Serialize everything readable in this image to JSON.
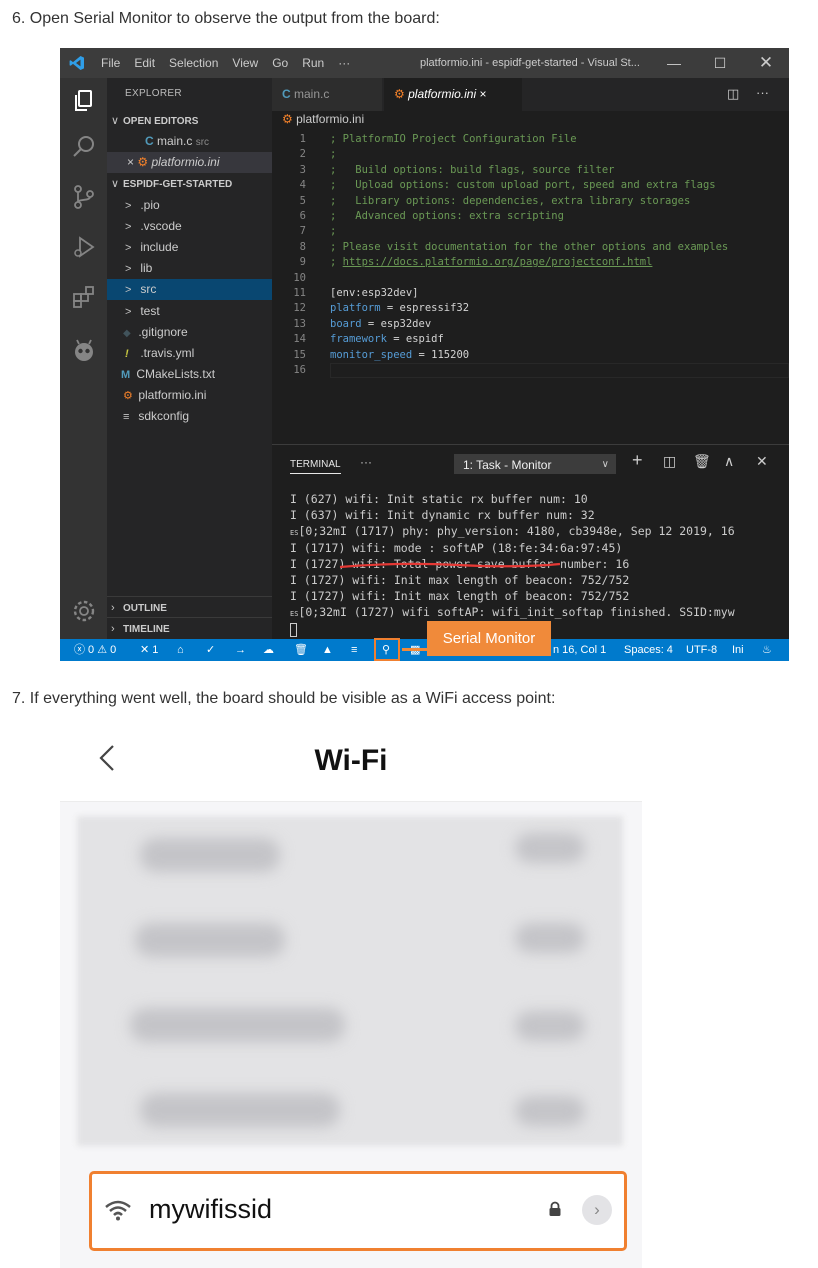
{
  "steps": {
    "step6": "6. Open Serial Monitor to observe the output from the board:",
    "step7": "7. If everything went well, the board should be visible as a WiFi access point:"
  },
  "vscode": {
    "menu": [
      "File",
      "Edit",
      "Selection",
      "View",
      "Go",
      "Run",
      "···"
    ],
    "window_title": "platformio.ini - espidf-get-started - Visual St...",
    "sidebar": {
      "header": "EXPLORER",
      "open_editors_label": "OPEN EDITORS",
      "open_editors": [
        {
          "icon": "C",
          "name": "main.c",
          "detail": "src"
        },
        {
          "icon": "×",
          "name": "platformio.ini",
          "detail": ""
        }
      ],
      "project_label": "ESPIDF-GET-STARTED",
      "tree": [
        {
          "prefix": ">",
          "name": ".pio"
        },
        {
          "prefix": ">",
          "name": ".vscode"
        },
        {
          "prefix": ">",
          "name": "include"
        },
        {
          "prefix": ">",
          "name": "lib"
        },
        {
          "prefix": ">",
          "name": "src"
        },
        {
          "prefix": ">",
          "name": "test"
        },
        {
          "prefix": "◆",
          "name": ".gitignore"
        },
        {
          "prefix": "!",
          "name": ".travis.yml"
        },
        {
          "prefix": "M",
          "name": "CMakeLists.txt"
        },
        {
          "prefix": "⚙",
          "name": "platformio.ini"
        },
        {
          "prefix": "≡",
          "name": "sdkconfig"
        }
      ],
      "outline_label": "OUTLINE",
      "timeline_label": "TIMELINE"
    },
    "tabs": [
      {
        "icon": "C",
        "label": "main.c"
      },
      {
        "icon": "⚙",
        "label": "platformio.ini",
        "close": "×"
      }
    ],
    "breadcrumb": "platformio.ini",
    "code_lines": [
      {
        "n": "1",
        "text": "; PlatformIO Project Configuration File",
        "kind": "comment"
      },
      {
        "n": "2",
        "text": ";",
        "kind": "comment"
      },
      {
        "n": "3",
        "text": ";   Build options: build flags, source filter",
        "kind": "comment"
      },
      {
        "n": "4",
        "text": ";   Upload options: custom upload port, speed and extra flags",
        "kind": "comment"
      },
      {
        "n": "5",
        "text": ";   Library options: dependencies, extra library storages",
        "kind": "comment"
      },
      {
        "n": "6",
        "text": ";   Advanced options: extra scripting",
        "kind": "comment"
      },
      {
        "n": "7",
        "text": ";",
        "kind": "comment"
      },
      {
        "n": "8",
        "text": "; Please visit documentation for the other options and examples",
        "kind": "comment"
      },
      {
        "n": "9",
        "text": "; ",
        "link": "https://docs.platformio.org/page/projectconf.html",
        "kind": "link"
      },
      {
        "n": "10",
        "text": "",
        "kind": "plain"
      },
      {
        "n": "11",
        "text": "[env:esp32dev]",
        "kind": "plain"
      },
      {
        "n": "12",
        "key": "platform",
        "text": " = espressif32",
        "kind": "kv"
      },
      {
        "n": "13",
        "key": "board",
        "text": " = esp32dev",
        "kind": "kv"
      },
      {
        "n": "14",
        "key": "framework",
        "text": " = espidf",
        "kind": "kv"
      },
      {
        "n": "15",
        "key": "monitor_speed",
        "text": " = 115200",
        "kind": "kv"
      },
      {
        "n": "16",
        "text": "",
        "kind": "plain"
      }
    ],
    "terminal": {
      "tab_label": "TERMINAL",
      "dots": "···",
      "task_select": "1: Task - Monitor",
      "lines": [
        {
          "esc": "",
          "text": "I (627) wifi: Init static rx buffer num: 10"
        },
        {
          "esc": "",
          "text": "I (637) wifi: Init dynamic rx buffer num: 32"
        },
        {
          "esc": "ES",
          "text": "[0;32mI (1717) phy: phy_version: 4180, cb3948e, Sep 12 2019, 16"
        },
        {
          "esc": "",
          "text": "I (1717) wifi: mode : softAP (18:fe:34:6a:97:45)"
        },
        {
          "esc": "",
          "text": "I (1727) wifi: Total power save buffer number: 16"
        },
        {
          "esc": "",
          "text": "I (1727) wifi: Init max length of beacon: 752/752"
        },
        {
          "esc": "",
          "text": "I (1727) wifi: Init max length of beacon: 752/752"
        },
        {
          "esc": "ES",
          "text": "[0;32mI (1727) wifi softAP: wifi_init_softap finished. SSID:myw"
        }
      ]
    },
    "status": {
      "problems": "ⓧ 0 ⚠ 0",
      "tasks": "✕ 1",
      "cursor_pos": "n 16, Col 1",
      "spaces": "Spaces: 4",
      "encoding": "UTF-8",
      "language": "Ini"
    },
    "callout": "Serial Monitor",
    "colors": {
      "statusbar": "#007acc",
      "callout": "#f08a3a",
      "highlight_box": "#f08030",
      "underline": "#e53935"
    }
  },
  "phone": {
    "title": "Wi-Fi",
    "network_name": "mywifissid",
    "info_glyph": "›"
  }
}
